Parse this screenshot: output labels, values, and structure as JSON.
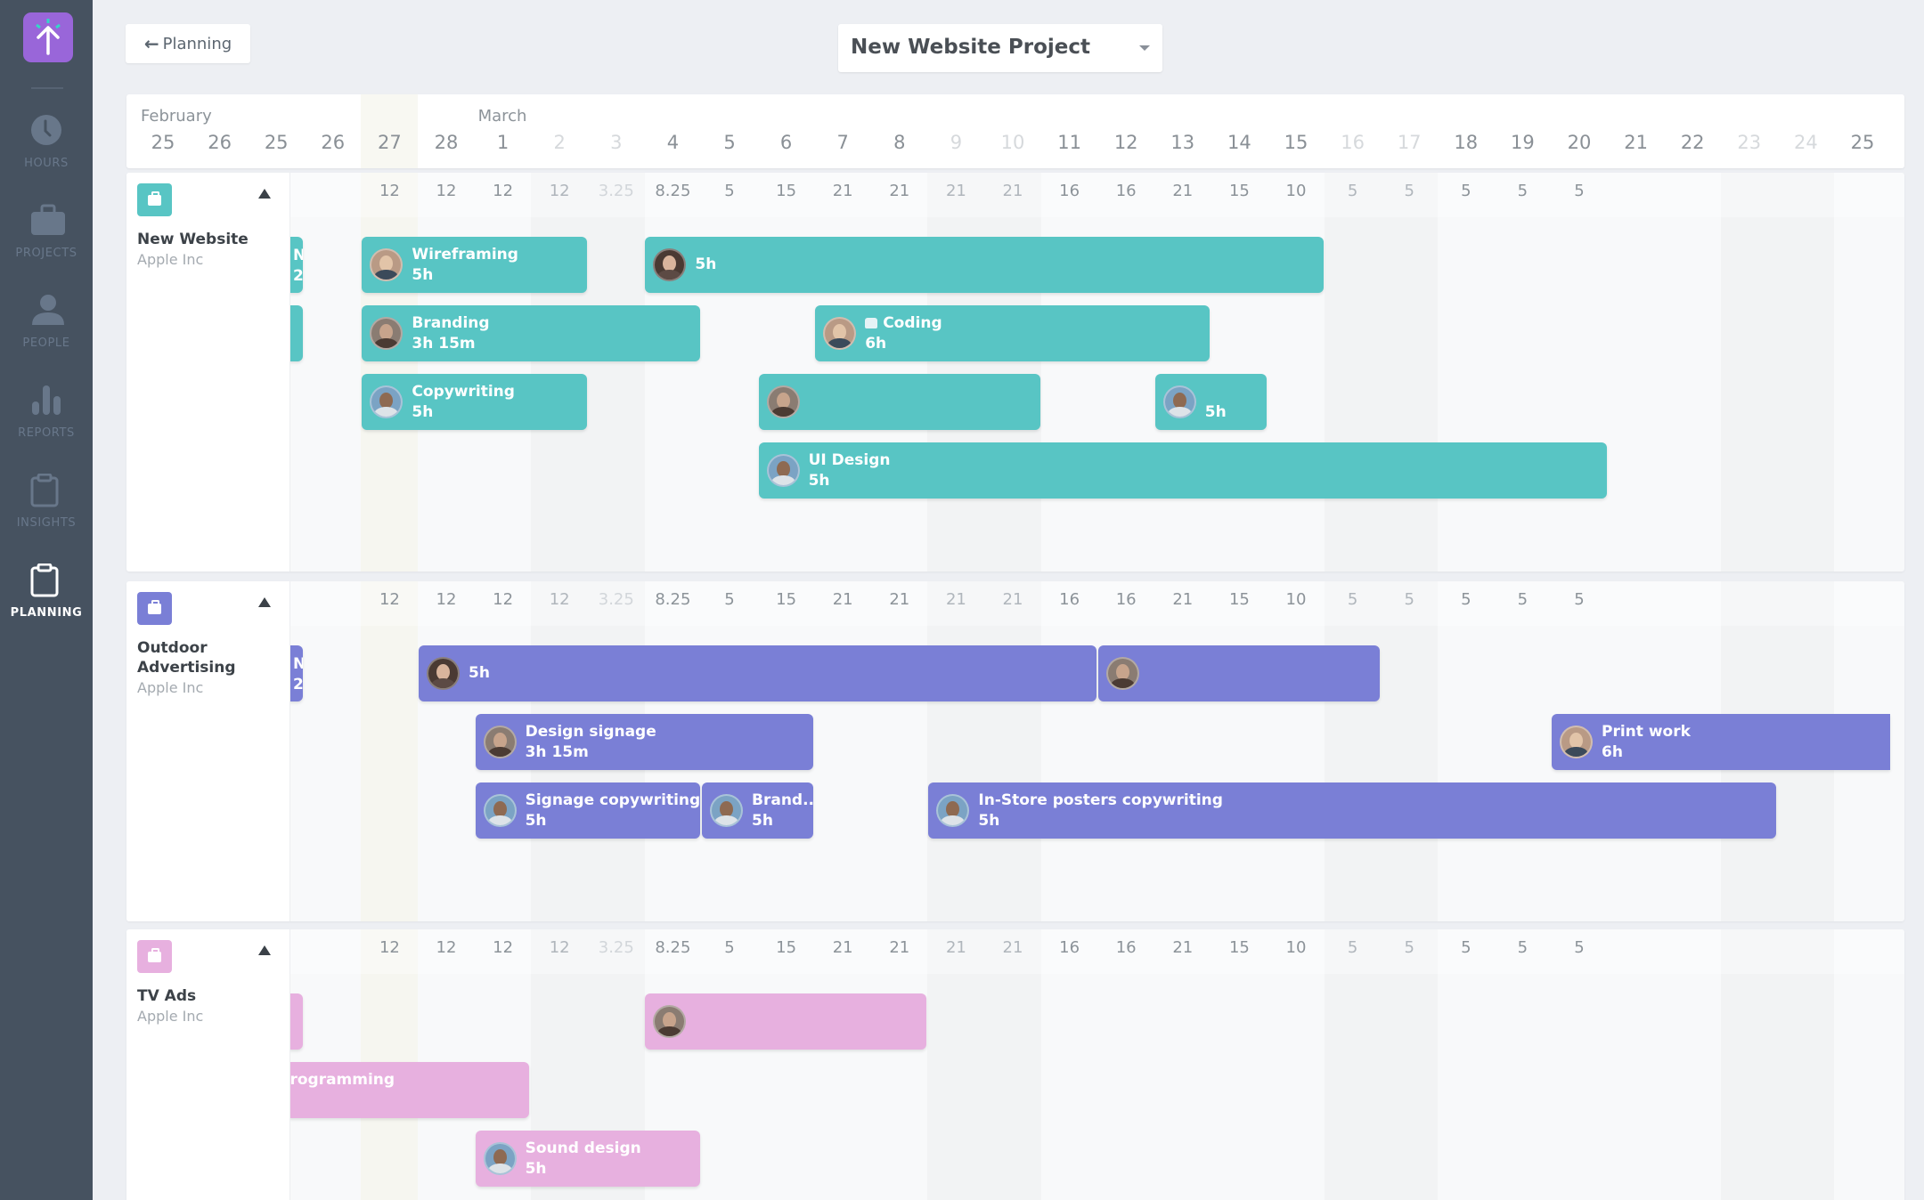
{
  "sidebar": {
    "logo": "app-logo",
    "items": [
      {
        "key": "hours",
        "label": "HOURS",
        "icon": "clock-icon",
        "active": false
      },
      {
        "key": "projects",
        "label": "PROJECTS",
        "icon": "briefcase-icon",
        "active": false
      },
      {
        "key": "people",
        "label": "PEOPLE",
        "icon": "person-icon",
        "active": false
      },
      {
        "key": "reports",
        "label": "REPORTS",
        "icon": "bar-chart-icon",
        "active": false
      },
      {
        "key": "insights",
        "label": "INSIGHTS",
        "icon": "clipboard-icon",
        "active": false
      },
      {
        "key": "planning",
        "label": "PLANNING",
        "icon": "clipboard-icon",
        "active": true
      }
    ]
  },
  "toolbar": {
    "back_label": "Planning",
    "back_icon": "arrow-left-icon",
    "project_select_value": "New Website Project"
  },
  "timeline": {
    "months": [
      {
        "label": "February",
        "col": 0
      },
      {
        "label": "March",
        "col": 6
      }
    ],
    "days": [
      {
        "d": "25",
        "muted": false
      },
      {
        "d": "26",
        "muted": false
      },
      {
        "d": "25",
        "muted": false
      },
      {
        "d": "26",
        "muted": false
      },
      {
        "d": "27",
        "muted": false,
        "today": true
      },
      {
        "d": "28",
        "muted": false
      },
      {
        "d": "1",
        "muted": false
      },
      {
        "d": "2",
        "muted": true
      },
      {
        "d": "3",
        "muted": true
      },
      {
        "d": "4",
        "muted": false
      },
      {
        "d": "5",
        "muted": false
      },
      {
        "d": "6",
        "muted": false
      },
      {
        "d": "7",
        "muted": false
      },
      {
        "d": "8",
        "muted": false
      },
      {
        "d": "9",
        "muted": true
      },
      {
        "d": "10",
        "muted": true
      },
      {
        "d": "11",
        "muted": false
      },
      {
        "d": "12",
        "muted": false
      },
      {
        "d": "13",
        "muted": false
      },
      {
        "d": "14",
        "muted": false
      },
      {
        "d": "15",
        "muted": false
      },
      {
        "d": "16",
        "muted": true
      },
      {
        "d": "17",
        "muted": true
      },
      {
        "d": "18",
        "muted": false
      },
      {
        "d": "19",
        "muted": false
      },
      {
        "d": "20",
        "muted": false
      },
      {
        "d": "21",
        "muted": false
      },
      {
        "d": "22",
        "muted": false
      },
      {
        "d": "23",
        "muted": true
      },
      {
        "d": "24",
        "muted": true
      },
      {
        "d": "25",
        "muted": false
      }
    ],
    "weekend_cols": [
      7,
      8,
      14,
      15,
      21,
      22,
      28,
      29
    ],
    "today_col": 4,
    "hours_start_col": 4,
    "hours": [
      "12",
      "12",
      "12",
      "12",
      "3.25",
      "8.25",
      "5",
      "15",
      "21",
      "21",
      "21",
      "21",
      "16",
      "16",
      "21",
      "15",
      "10",
      "5",
      "5",
      "5",
      "5",
      "5"
    ]
  },
  "colors": {
    "new_website": "#58c5c4",
    "outdoor_advertising": "#7a7fd6",
    "tv_ads": "#e7b0df",
    "logo": "#9966d9",
    "sidebar": "#465260"
  },
  "projects": [
    {
      "name": "New Website",
      "client": "Apple Inc",
      "color_key": "new_website",
      "bars": [
        {
          "row": 0,
          "start": 0,
          "span": 3,
          "title": "N",
          "dur": "2",
          "clipped_left": true,
          "avatar": "none"
        },
        {
          "row": 1,
          "start": 0,
          "span": 3,
          "title": "",
          "dur": "",
          "clipped_left": true,
          "avatar": "none"
        },
        {
          "row": 0,
          "start": 4,
          "span": 4,
          "title": "Wireframing",
          "dur": "5h",
          "avatar": "woman-blonde"
        },
        {
          "row": 0,
          "start": 9,
          "span": 12,
          "title": "",
          "dur": "5h",
          "avatar": "woman-dark"
        },
        {
          "row": 1,
          "start": 4,
          "span": 6,
          "title": "Branding",
          "dur": "3h 15m",
          "avatar": "man-bald"
        },
        {
          "row": 1,
          "start": 12,
          "span": 7,
          "title": "Coding",
          "dur": "6h",
          "avatar": "woman-blonde",
          "emoji": true
        },
        {
          "row": 2,
          "start": 4,
          "span": 4,
          "title": "Copywriting",
          "dur": "5h",
          "avatar": "man-beard"
        },
        {
          "row": 2,
          "start": 11,
          "span": 5,
          "title": "",
          "dur": "",
          "avatar": "man-bald"
        },
        {
          "row": 2,
          "start": 18,
          "span": 2,
          "title": "",
          "dur": "5h",
          "avatar": "man-beard",
          "dur_low": true
        },
        {
          "row": 3,
          "start": 11,
          "span": 15,
          "title": "UI Design",
          "dur": "5h",
          "avatar": "man-beard"
        }
      ]
    },
    {
      "name": "Outdoor Advertising",
      "client": "Apple Inc",
      "color_key": "outdoor_advertising",
      "bars": [
        {
          "row": 0,
          "start": 0,
          "span": 3,
          "title": "N",
          "dur": "2",
          "clipped_left": true,
          "avatar": "none"
        },
        {
          "row": 0,
          "start": 5,
          "span": 12,
          "title": "",
          "dur": "5h",
          "avatar": "woman-dark"
        },
        {
          "row": 0,
          "start": 17,
          "span": 5,
          "title": "",
          "dur": "",
          "avatar": "man-bald"
        },
        {
          "row": 1,
          "start": 6,
          "span": 6,
          "title": "Design signage",
          "dur": "3h 15m",
          "avatar": "man-bald"
        },
        {
          "row": 1,
          "start": 25,
          "span": 6,
          "title": "Print work",
          "dur": "6h",
          "avatar": "woman-blonde",
          "clipped_right": true
        },
        {
          "row": 2,
          "start": 6,
          "span": 4,
          "title": "Signage copywriting",
          "dur": "5h",
          "avatar": "man-beard"
        },
        {
          "row": 2,
          "start": 10,
          "span": 2,
          "title": "Brand...",
          "dur": "5h",
          "avatar": "man-beard"
        },
        {
          "row": 2,
          "start": 14,
          "span": 15,
          "title": "In-Store posters copywriting",
          "dur": "5h",
          "avatar": "man-beard"
        }
      ]
    },
    {
      "name": "TV Ads",
      "client": "Apple Inc",
      "color_key": "tv_ads",
      "bars": [
        {
          "row": 0,
          "start": 0,
          "span": 3,
          "title": "",
          "dur": "",
          "clipped_left": true,
          "avatar": "none"
        },
        {
          "row": 0,
          "start": 9,
          "span": 5,
          "title": "",
          "dur": "",
          "avatar": "man-bald"
        },
        {
          "row": 1,
          "start": 0,
          "span": 7,
          "title": "Programming",
          "dur": "",
          "clipped_left": true,
          "avatar": "none",
          "hidden_prefix": true
        },
        {
          "row": 2,
          "start": 6,
          "span": 4,
          "title": "Sound design",
          "dur": "5h",
          "avatar": "man-beard"
        }
      ]
    }
  ]
}
